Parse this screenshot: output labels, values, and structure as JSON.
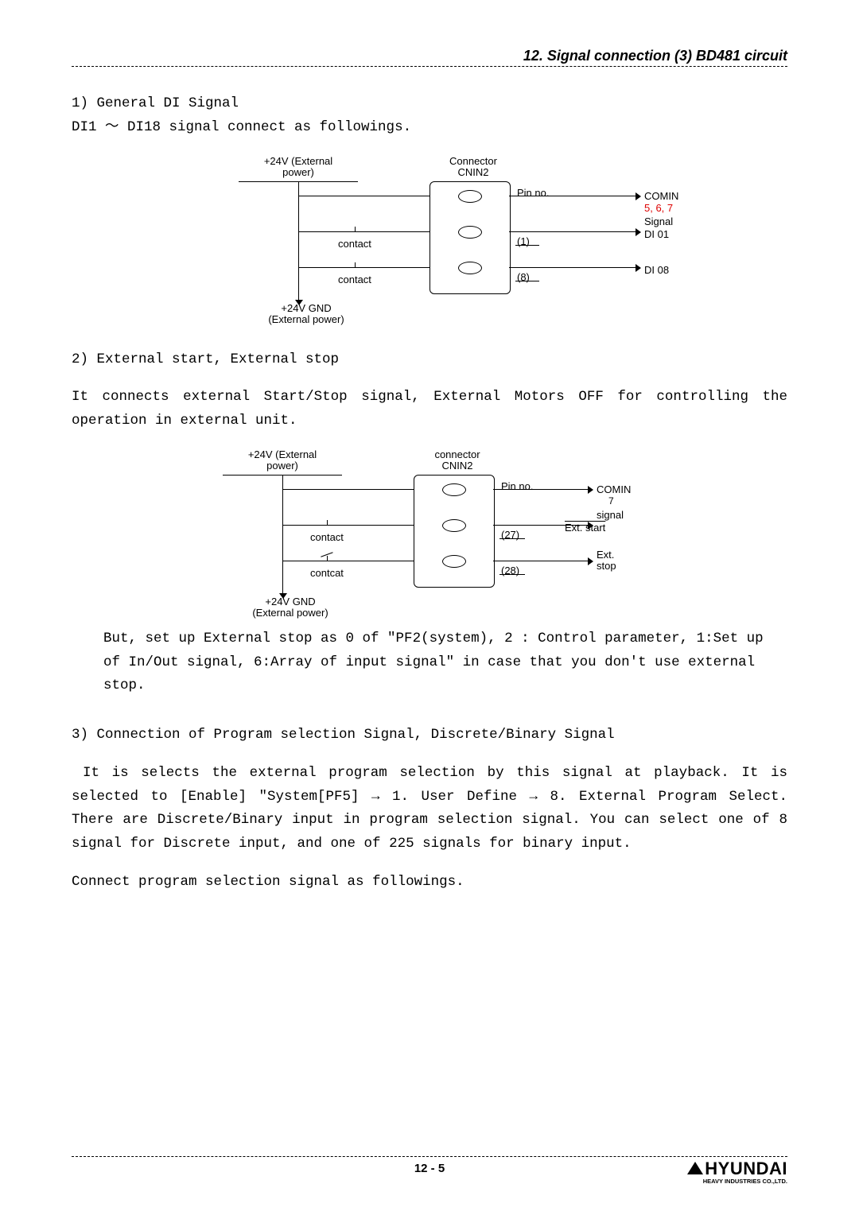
{
  "header": {
    "title": "12. Signal connection (3) BD481 circuit"
  },
  "sec1": {
    "heading": "1) General  DI Signal",
    "line": "DI1 ～ DI18 signal connect as followings."
  },
  "diag1": {
    "power": "+24V (External power)",
    "connector": "Connector CNIN2",
    "pinno": "Pin no.",
    "contact1": "contact",
    "contact2": "contact",
    "pin1": "(1)",
    "pin8": "(8)",
    "comin": "COMIN",
    "comin_pins": "5, 6, 7",
    "signal": "Signal",
    "di01": "DI 01",
    "di08": "DI 08",
    "gnd": "+24V GND (External power)"
  },
  "sec2": {
    "heading": "2) External start, External stop",
    "para": "It connects external Start/Stop signal, External Motors OFF for controlling the operation in external unit."
  },
  "diag2": {
    "power": "+24V (External power)",
    "connector": "connector CNIN2",
    "pinno": "Pin no.",
    "contact1": "contact",
    "contact2": "contcat",
    "pin27": "(27)",
    "pin28": "(28)",
    "comin": "COMIN",
    "comin_pins": "7",
    "signal": "signal",
    "extstart": "Ext. start",
    "extstop": "Ext. stop",
    "gnd": "+24V GND (External power)"
  },
  "note2": "But, set up External stop as 0 of \"PF2(system), 2 : Control parameter, 1:Set up of In/Out signal, 6:Array of input signal\" in case that you don't use external stop.",
  "sec3": {
    "heading": "3) Connection of Program selection Signal, Discrete/Binary Signal",
    "para1": "It is selects the external program selection by this signal at playback. It is selected to [Enable] \"System[PF5] →  1. User Define →  8. External Program Select. There are Discrete/Binary input in program selection signal. You can select one of 8 signal for Discrete input, and one of 225 signals for binary input.",
    "para2": "Connect program selection signal as followings."
  },
  "footer": {
    "page": "12 - 5",
    "logo": "HYUNDAI",
    "logo_sub": "HEAVY INDUSTRIES CO.,LTD."
  }
}
